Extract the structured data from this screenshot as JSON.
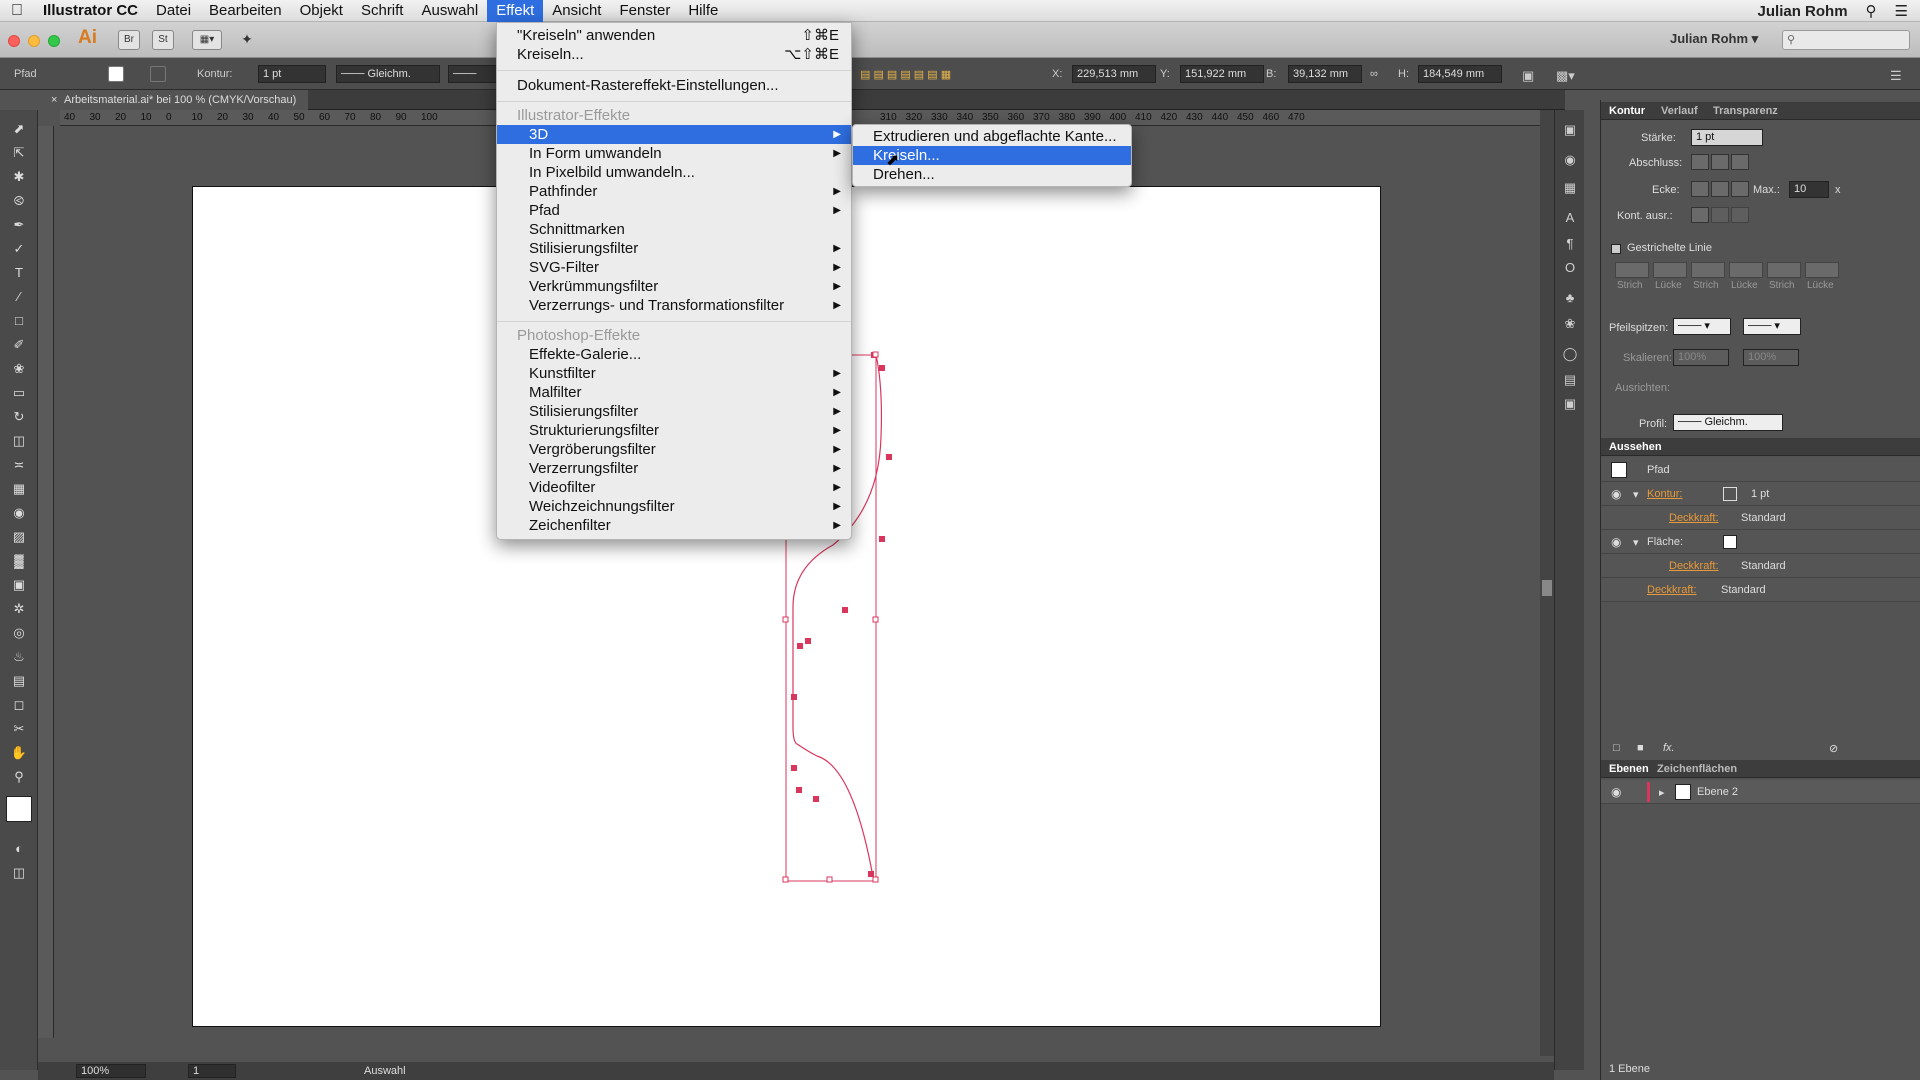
{
  "menubar": {
    "apple": "",
    "app": "Illustrator CC",
    "items": [
      "Datei",
      "Bearbeiten",
      "Objekt",
      "Schrift",
      "Auswahl",
      "Effekt",
      "Ansicht",
      "Fenster",
      "Hilfe"
    ],
    "user": "Julian Rohm"
  },
  "appbar": {
    "logo": "Ai",
    "br": "Br",
    "st": "St",
    "workspace": "Julian Rohm"
  },
  "control": {
    "object_type": "Pfad",
    "kontur_label": "Kontur:",
    "kontur_value": "1 pt",
    "profile": "Gleichm.",
    "x_label": "X:",
    "x": "229,513 mm",
    "y_label": "Y:",
    "y": "151,922 mm",
    "b_label": "B:",
    "b": "39,132 mm",
    "h_label": "H:",
    "h": "184,549 mm"
  },
  "document": {
    "tab_title": "Arbeitsmaterial.ai* bei 100 % (CMYK/Vorschau)",
    "ruler_h": [
      "40",
      "30",
      "20",
      "10",
      "0",
      "10",
      "20",
      "30",
      "40",
      "50",
      "60",
      "70",
      "80",
      "90",
      "100",
      "310",
      "320",
      "330",
      "340",
      "350",
      "360",
      "370",
      "380",
      "390",
      "400",
      "410",
      "420",
      "430",
      "440",
      "450",
      "460",
      "470"
    ]
  },
  "effekt_menu": {
    "apply_last": "\"Kreiseln\" anwenden",
    "apply_last_sc": "⇧⌘E",
    "last": "Kreiseln...",
    "last_sc": "⌥⇧⌘E",
    "raster_settings": "Dokument-Rastereffekt-Einstellungen...",
    "illustrator_header": "Illustrator-Effekte",
    "illustrator_items": [
      "3D",
      "In Form umwandeln",
      "In Pixelbild umwandeln...",
      "Pathfinder",
      "Pfad",
      "Schnittmarken",
      "Stilisierungsfilter",
      "SVG-Filter",
      "Verkrümmungsfilter",
      "Verzerrungs- und Transformationsfilter"
    ],
    "photoshop_header": "Photoshop-Effekte",
    "photoshop_items": [
      "Effekte-Galerie...",
      "Kunstfilter",
      "Malfilter",
      "Stilisierungsfilter",
      "Strukturierungsfilter",
      "Vergröberungsfilter",
      "Verzerrungsfilter",
      "Videofilter",
      "Weichzeichnungsfilter",
      "Zeichenfilter"
    ]
  },
  "submenu_3d": {
    "items": [
      "Extrudieren und abgeflachte Kante...",
      "Kreiseln...",
      "Drehen..."
    ],
    "selected": "Kreiseln..."
  },
  "kontur_panel": {
    "tabs": [
      "Kontur",
      "Verlauf",
      "Transparenz"
    ],
    "staerke_label": "Stärke:",
    "staerke": "1 pt",
    "abschluss_label": "Abschluss:",
    "ecke_label": "Ecke:",
    "max_label": "Max.:",
    "max": "10",
    "max_unit": "x",
    "kont_ausr_label": "Kont. ausr.:",
    "dashed_label": "Gestrichelte Linie",
    "dash_labels": [
      "Strich",
      "Lücke",
      "Strich",
      "Lücke",
      "Strich",
      "Lücke"
    ],
    "pfeilspitzen_label": "Pfeilspitzen:",
    "skalieren_label": "Skalieren:",
    "skal_1": "100%",
    "skal_2": "100%",
    "ausrichten_label": "Ausrichten:",
    "profil_label": "Profil:",
    "profil": "Gleichm."
  },
  "aussehen_panel": {
    "title": "Aussehen",
    "object": "Pfad",
    "kontur": "Kontur:",
    "kontur_value": "1 pt",
    "deckkraft": "Deckkraft:",
    "standard": "Standard",
    "flaeche": "Fläche:",
    "fx": "fx."
  },
  "ebenen_panel": {
    "tabs": [
      "Ebenen",
      "Zeichenflächen"
    ],
    "layer": "Ebene 2",
    "count": "1 Ebene"
  },
  "status": {
    "zoom": "100%",
    "artboard": "1",
    "tool": "Auswahl"
  },
  "colors": {
    "menu_highlight": "#2e6ee0",
    "path_stroke": "#d9365e",
    "aussehen_link": "#e79a3a"
  }
}
